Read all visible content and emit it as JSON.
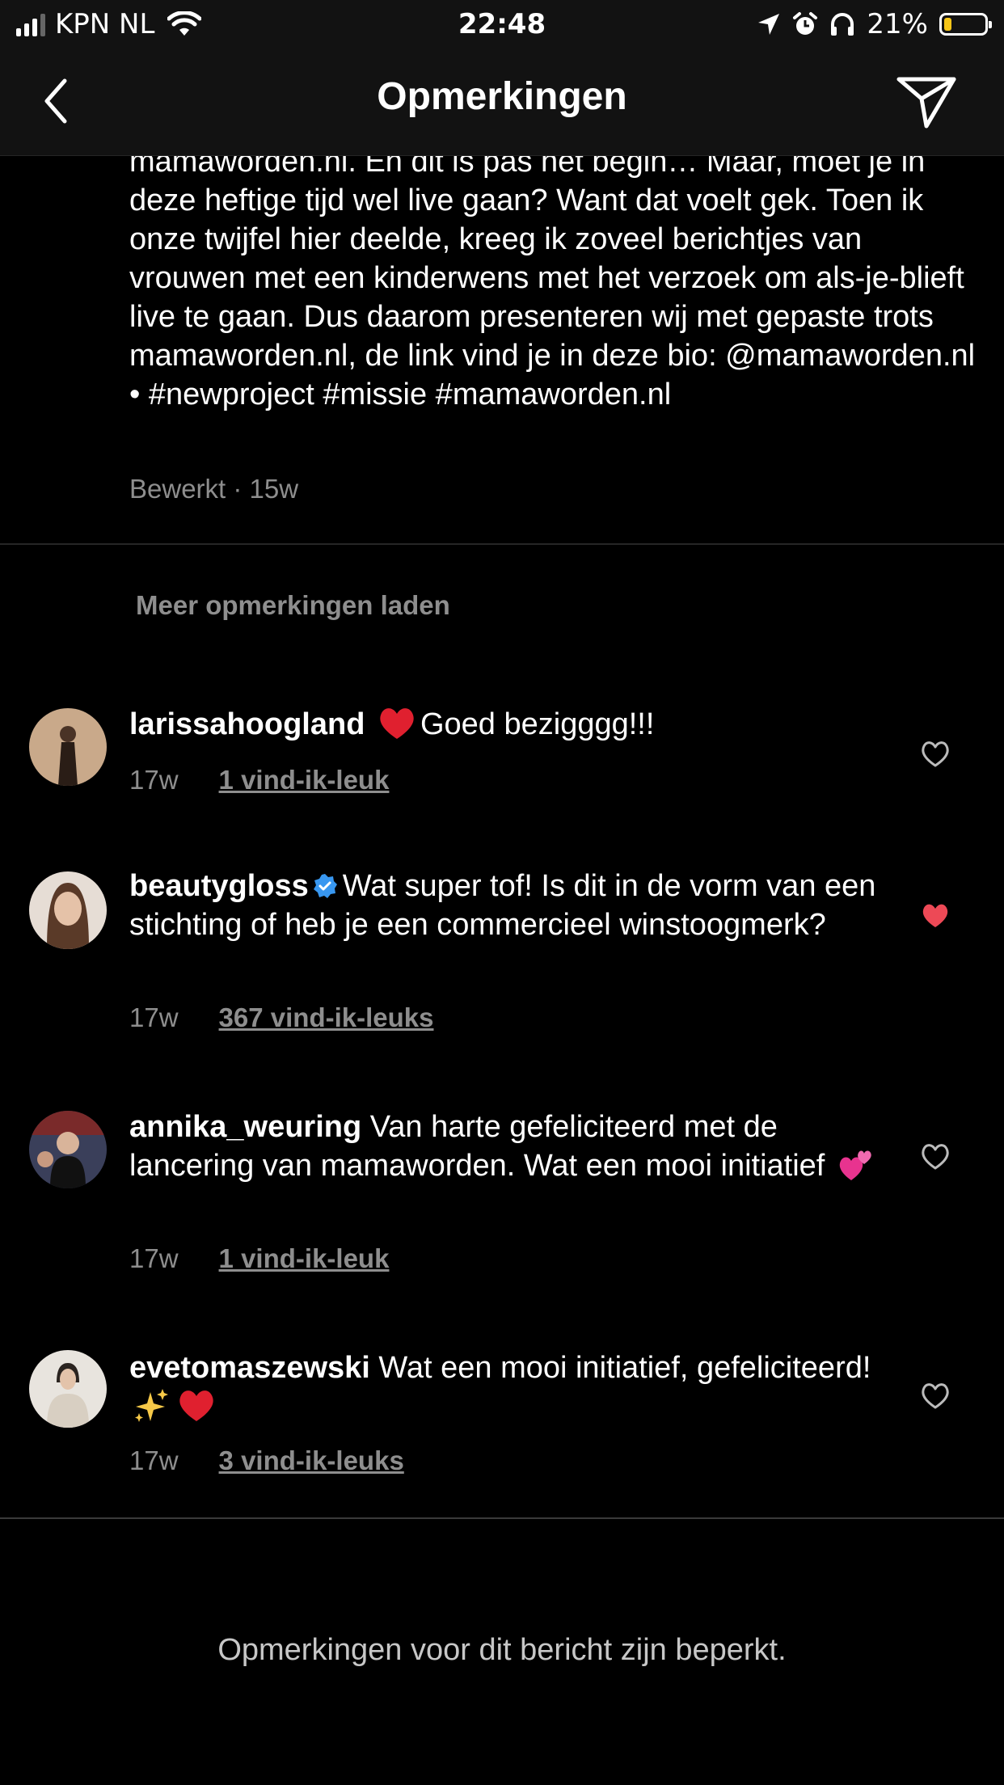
{
  "status_bar": {
    "carrier": "KPN NL",
    "time": "22:48",
    "battery": "21%",
    "battery_level": 0.21
  },
  "header": {
    "title": "Opmerkingen",
    "back_icon": "chevron-left-icon",
    "send_icon": "paper-plane-icon"
  },
  "caption": {
    "text": "mamaworden.nl. En dit is pas het begin… Maar, moet je in deze heftige tijd wel live gaan? Want dat voelt gek. Toen ik onze twijfel hier deelde, kreeg ik zoveel berichtjes van vrouwen met een kinderwens met het verzoek om als-je-blieft live te gaan. Dus daarom presenteren wij met gepaste trots mamaworden.nl, de link vind je in deze bio: @mamaworden.nl • #newproject #missie #mamaworden.nl",
    "meta": "Bewerkt · 15w"
  },
  "load_more": "Meer opmerkingen laden",
  "comments": [
    {
      "username": "larissahoogland",
      "text": "Goed bezigggg!!!",
      "time": "17w",
      "likes": "1 vind-ik-leuk",
      "liked": false
    },
    {
      "username": "beautygloss",
      "verified": true,
      "text": "Wat super tof! Is dit in de vorm van een stichting of heb je een commercieel winstoogmerk?",
      "time": "17w",
      "likes": "367 vind-ik-leuks",
      "liked": true
    },
    {
      "username": "annika_weuring",
      "text": "Van harte gefeliciteerd met de lancering van mamaworden. Wat een mooi initiatief",
      "time": "17w",
      "likes": "1 vind-ik-leuk",
      "liked": false
    },
    {
      "username": "evetomaszewski",
      "text": "Wat een mooi initiatief, gefeliciteerd!",
      "time": "17w",
      "likes": "3 vind-ik-leuks",
      "liked": false
    }
  ],
  "footer": {
    "restricted": "Opmerkingen voor dit bericht zijn beperkt."
  },
  "colors": {
    "background": "#000000",
    "bar": "#121212",
    "muted": "#8e8e8e",
    "like_red": "#ed4956",
    "verified_blue": "#3897f0"
  }
}
